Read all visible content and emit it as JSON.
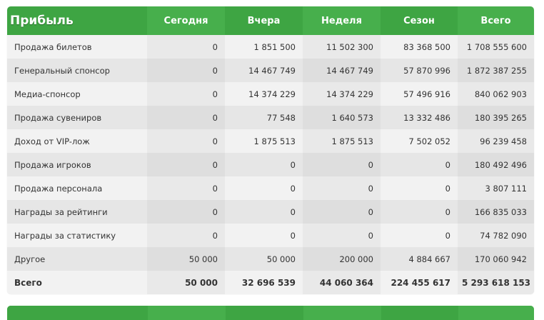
{
  "table": {
    "title": "Прибыль",
    "columns": [
      "Сегодня",
      "Вчера",
      "Неделя",
      "Сезон",
      "Всего"
    ],
    "rows": [
      {
        "label": "Продажа билетов",
        "values": [
          "0",
          "1 851 500",
          "11 502 300",
          "83 368 500",
          "1 708 555 600"
        ]
      },
      {
        "label": "Генеральный спонсор",
        "values": [
          "0",
          "14 467 749",
          "14 467 749",
          "57 870 996",
          "1 872 387 255"
        ]
      },
      {
        "label": "Медиа-спонсор",
        "values": [
          "0",
          "14 374 229",
          "14 374 229",
          "57 496 916",
          "840 062 903"
        ]
      },
      {
        "label": "Продажа сувениров",
        "values": [
          "0",
          "77 548",
          "1 640 573",
          "13 332 486",
          "180 395 265"
        ]
      },
      {
        "label": "Доход от VIP-лож",
        "values": [
          "0",
          "1 875 513",
          "1 875 513",
          "7 502 052",
          "96 239 458"
        ]
      },
      {
        "label": "Продажа игроков",
        "values": [
          "0",
          "0",
          "0",
          "0",
          "180 492 496"
        ]
      },
      {
        "label": "Продажа персонала",
        "values": [
          "0",
          "0",
          "0",
          "0",
          "3 807 111"
        ]
      },
      {
        "label": "Награды за рейтинги",
        "values": [
          "0",
          "0",
          "0",
          "0",
          "166 835 033"
        ]
      },
      {
        "label": "Награды за статистику",
        "values": [
          "0",
          "0",
          "0",
          "0",
          "74 782 090"
        ]
      },
      {
        "label": "Другое",
        "values": [
          "50 000",
          "50 000",
          "200 000",
          "4 884 667",
          "170 060 942"
        ]
      }
    ],
    "total": {
      "label": "Всего",
      "values": [
        "50 000",
        "32 696 539",
        "44 060 364",
        "224 455 617",
        "5 293 618 153"
      ]
    }
  },
  "colors": {
    "header_green": "#3ea543",
    "header_green_alt": "#47af4c",
    "row_light": "#f2f2f2",
    "row_dark": "#e6e6e6"
  }
}
